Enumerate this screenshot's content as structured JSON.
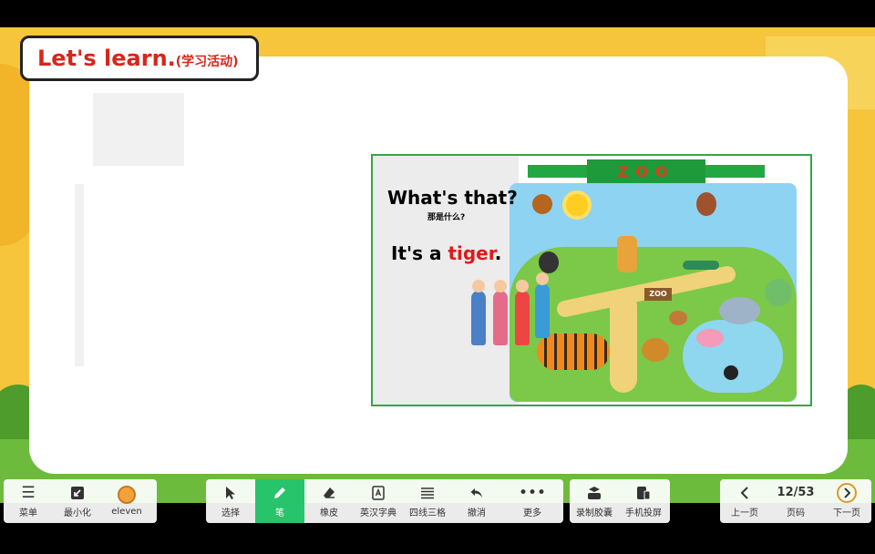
{
  "slide": {
    "title": "Let's learn.",
    "title_sub": "(学习活动)",
    "question": "What's that?",
    "question_cn": "那是什么?",
    "answer_prefix": "It's a ",
    "answer_word": "tiger",
    "answer_suffix": ".",
    "zoo_banner": "ZOO",
    "zoo_sign": "ZOO"
  },
  "toolbar": {
    "left": [
      {
        "label": "菜单",
        "icon": "menu-icon"
      },
      {
        "label": "最小化",
        "icon": "minimize-icon"
      },
      {
        "label": "eleven",
        "icon": "avatar-icon"
      }
    ],
    "tools": [
      {
        "label": "选择",
        "icon": "cursor-icon"
      },
      {
        "label": "笔",
        "icon": "pen-icon",
        "active": true
      },
      {
        "label": "橡皮",
        "icon": "eraser-icon"
      },
      {
        "label": "英汉字典",
        "icon": "dictionary-icon"
      },
      {
        "label": "四线三格",
        "icon": "four-lines-icon"
      },
      {
        "label": "撤消",
        "icon": "undo-icon"
      },
      {
        "label": "更多",
        "icon": "more-icon"
      }
    ],
    "extra": [
      {
        "label": "录制胶囊",
        "icon": "record-icon"
      },
      {
        "label": "手机投屏",
        "icon": "phone-cast-icon"
      }
    ],
    "nav": {
      "prev_label": "上一页",
      "page_label": "页码",
      "page_value": "12/53",
      "next_label": "下一页"
    }
  }
}
